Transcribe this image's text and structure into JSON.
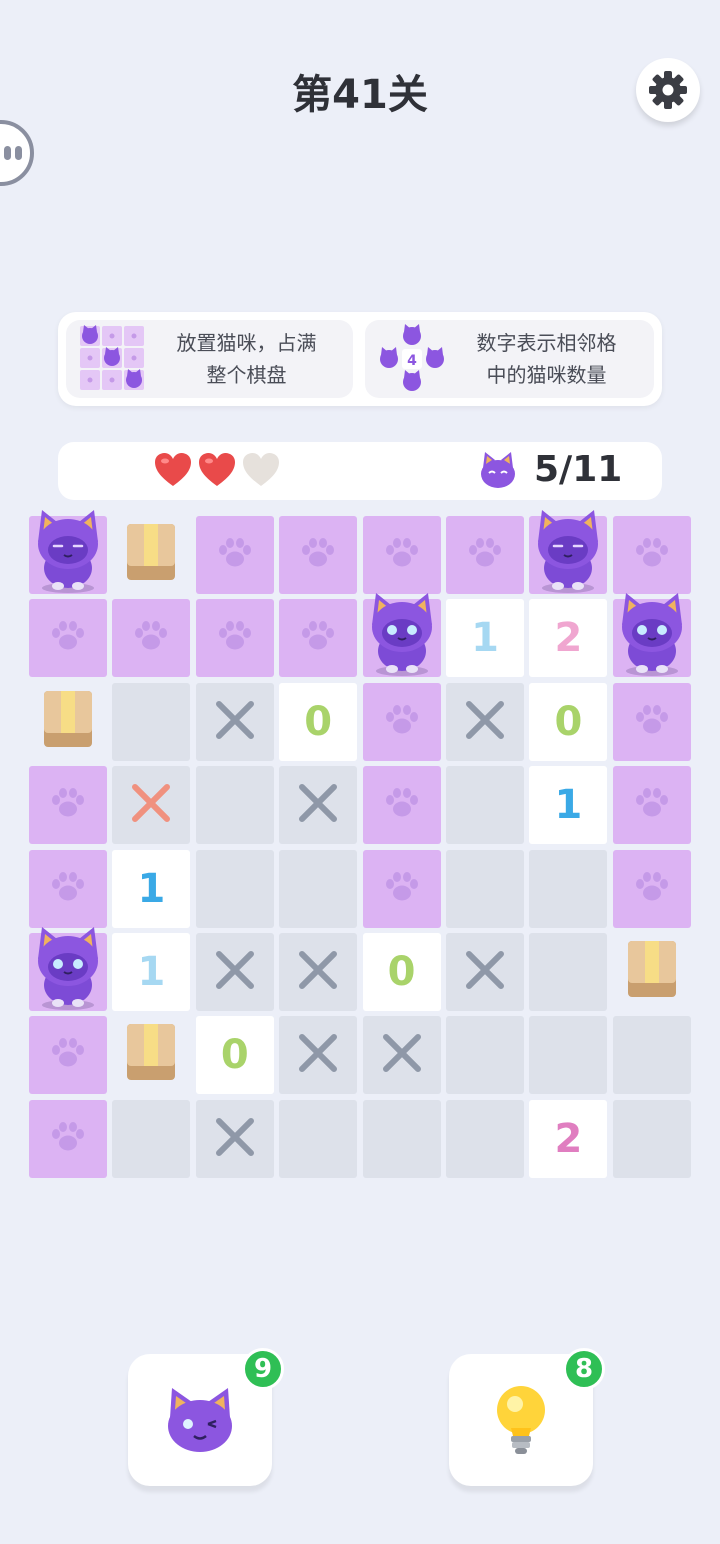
{
  "header": {
    "title": "第41关"
  },
  "icons": {
    "settings": "gear-icon",
    "side": "mascot-icon",
    "hint": "lightbulb-icon",
    "cat": "cat-icon"
  },
  "rules": [
    {
      "text_line1": "放置猫咪，占满",
      "text_line2": "整个棋盘"
    },
    {
      "text_line1": "数字表示相邻格",
      "text_line2": "中的猫咪数量",
      "icon_number": "4"
    }
  ],
  "status": {
    "lives_total": 3,
    "lives_remaining": 2,
    "cats_label": "5/11"
  },
  "board": {
    "size": 8,
    "cells": [
      [
        "cat",
        "box",
        "paw",
        "paw",
        "paw",
        "paw",
        "cat",
        "paw"
      ],
      [
        "paw",
        "paw",
        "paw",
        "paw",
        "cat",
        "n1",
        "n2",
        "cat"
      ],
      [
        "box",
        "empty",
        "x",
        "n0",
        "paw",
        "x",
        "n0",
        "paw"
      ],
      [
        "paw",
        "xr",
        "empty",
        "x",
        "paw",
        "empty",
        "n1",
        "paw"
      ],
      [
        "paw",
        "n1",
        "empty",
        "empty",
        "paw",
        "empty",
        "empty",
        "paw"
      ],
      [
        "cat",
        "n1",
        "x",
        "x",
        "n0",
        "x",
        "empty",
        "box"
      ],
      [
        "paw",
        "box",
        "n0",
        "x",
        "x",
        "empty",
        "empty",
        "empty"
      ],
      [
        "paw",
        "empty",
        "x",
        "empty",
        "empty",
        "empty",
        "n2",
        "empty"
      ]
    ],
    "number_colors": {
      "0": "#a9d36a",
      "1": "#3aa9e6",
      "2": "#ef8fc4"
    },
    "number_shades": {
      "1,5": "#a6d8f2",
      "1,6": "#f0a6d0",
      "2,3": "#a9d36a",
      "2,6": "#a9d36a",
      "3,6": "#3aa9e6",
      "4,1": "#3aa9e6",
      "5,1": "#a6d8f2",
      "5,4": "#a9d36a",
      "6,2": "#a9d36a",
      "7,6": "#e07ec0"
    }
  },
  "tools": {
    "cat": {
      "count": "9"
    },
    "hint": {
      "count": "8"
    }
  },
  "colors": {
    "purple_cell": "#dcb3f3",
    "gray_cell": "#dde1ea",
    "cat_body": "#8c56e0",
    "heart_full": "#e94a4a",
    "heart_empty": "#e6e1dc",
    "badge": "#2fbf55",
    "x_gray": "#8f98a8",
    "x_red": "#f0917f"
  }
}
